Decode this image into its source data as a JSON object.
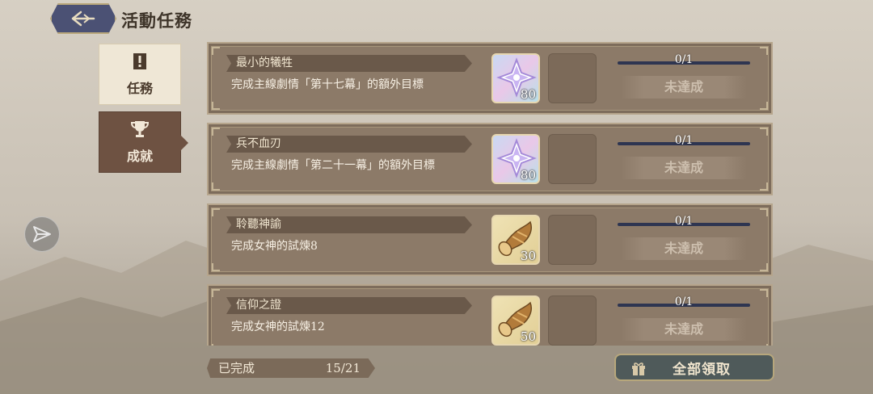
{
  "header": {
    "title": "活動任務"
  },
  "sidebar": {
    "tabs": [
      {
        "label": "任務",
        "icon": "scroll-exclaim-icon",
        "active": false
      },
      {
        "label": "成就",
        "icon": "trophy-icon",
        "active": true
      }
    ]
  },
  "achievements": [
    {
      "name": "最小的犧牲",
      "description": "完成主線劇情「第十七幕」的額外目標",
      "reward_icon": "crystal-icon",
      "reward_qty": "80",
      "progress": "0/1",
      "progress_fraction": 0,
      "status": "未達成"
    },
    {
      "name": "兵不血刃",
      "description": "完成主線劇情「第二十一幕」的額外目標",
      "reward_icon": "crystal-icon",
      "reward_qty": "80",
      "progress": "0/1",
      "progress_fraction": 0,
      "status": "未達成"
    },
    {
      "name": "聆聽神諭",
      "description": "完成女神的試煉8",
      "reward_icon": "horn-icon",
      "reward_qty": "30",
      "progress": "0/1",
      "progress_fraction": 0,
      "status": "未達成"
    },
    {
      "name": "信仰之證",
      "description": "完成女神的試煉12",
      "reward_icon": "horn-icon",
      "reward_qty": "50",
      "progress": "0/1",
      "progress_fraction": 0,
      "status": "未達成"
    }
  ],
  "footer": {
    "completed_label": "已完成",
    "completed_value": "15/21",
    "claim_all_label": "全部領取"
  },
  "colors": {
    "card_bg": "#8c7a68",
    "active_tab_bg": "#6e5242",
    "back_button_bg": "#4b5174",
    "claim_button_bg": "#4f5a5a",
    "progress_track": "#2e3551"
  }
}
